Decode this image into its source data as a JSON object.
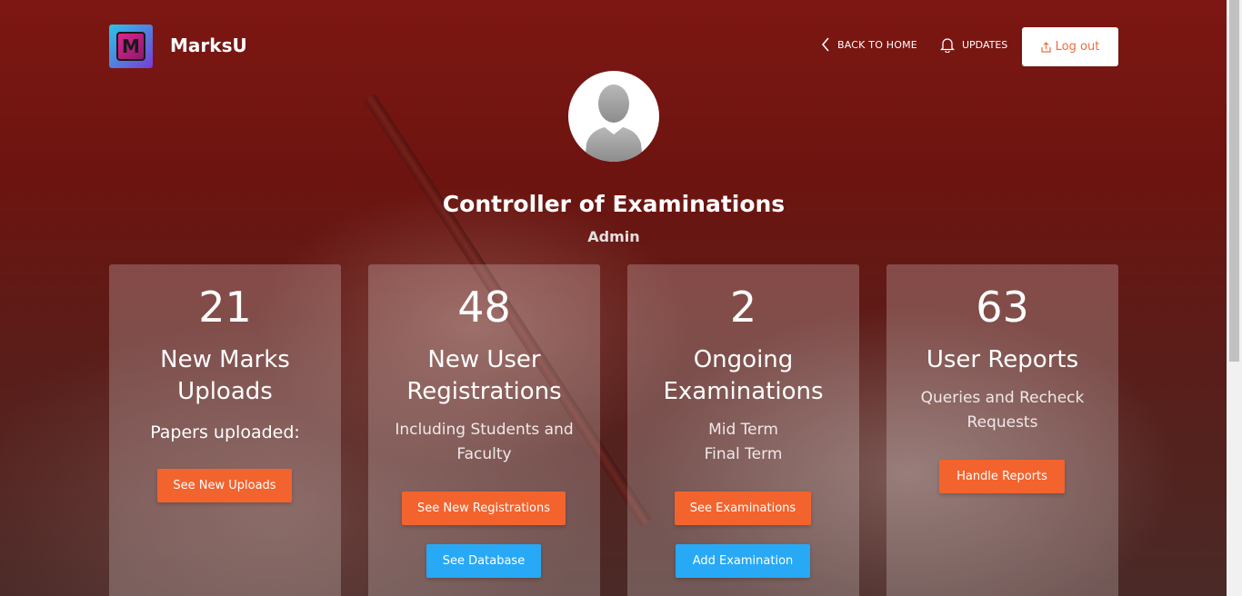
{
  "header": {
    "brand": "MarksU",
    "logo_letter": "M",
    "back_label": "BACK TO HOME",
    "updates_label": "UPDATES",
    "logout_label": "Log out"
  },
  "profile": {
    "title": "Controller of Examinations",
    "role": "Admin"
  },
  "cards": [
    {
      "count": "21",
      "title_line1": "New Marks",
      "title_line2": "Uploads",
      "desc_line1": "Papers uploaded:",
      "desc_line2": "",
      "primary_button": "See New Uploads"
    },
    {
      "count": "48",
      "title_line1": "New User",
      "title_line2": "Registrations",
      "desc_line1": "Including Students and",
      "desc_line2": "Faculty",
      "primary_button": "See New Registrations",
      "secondary_button": "See Database"
    },
    {
      "count": "2",
      "title_line1": "Ongoing",
      "title_line2": "Examinations",
      "desc_line1": "Mid Term",
      "desc_line2": "Final Term",
      "primary_button": "See Examinations",
      "secondary_button": "Add Examination"
    },
    {
      "count": "63",
      "title_line1": "User Reports",
      "title_line2": "",
      "desc_line1": "Queries and Recheck",
      "desc_line2": "Requests",
      "primary_button": "Handle Reports"
    }
  ],
  "colors": {
    "accent_orange": "#f3632e",
    "accent_blue": "#27a9f5"
  }
}
